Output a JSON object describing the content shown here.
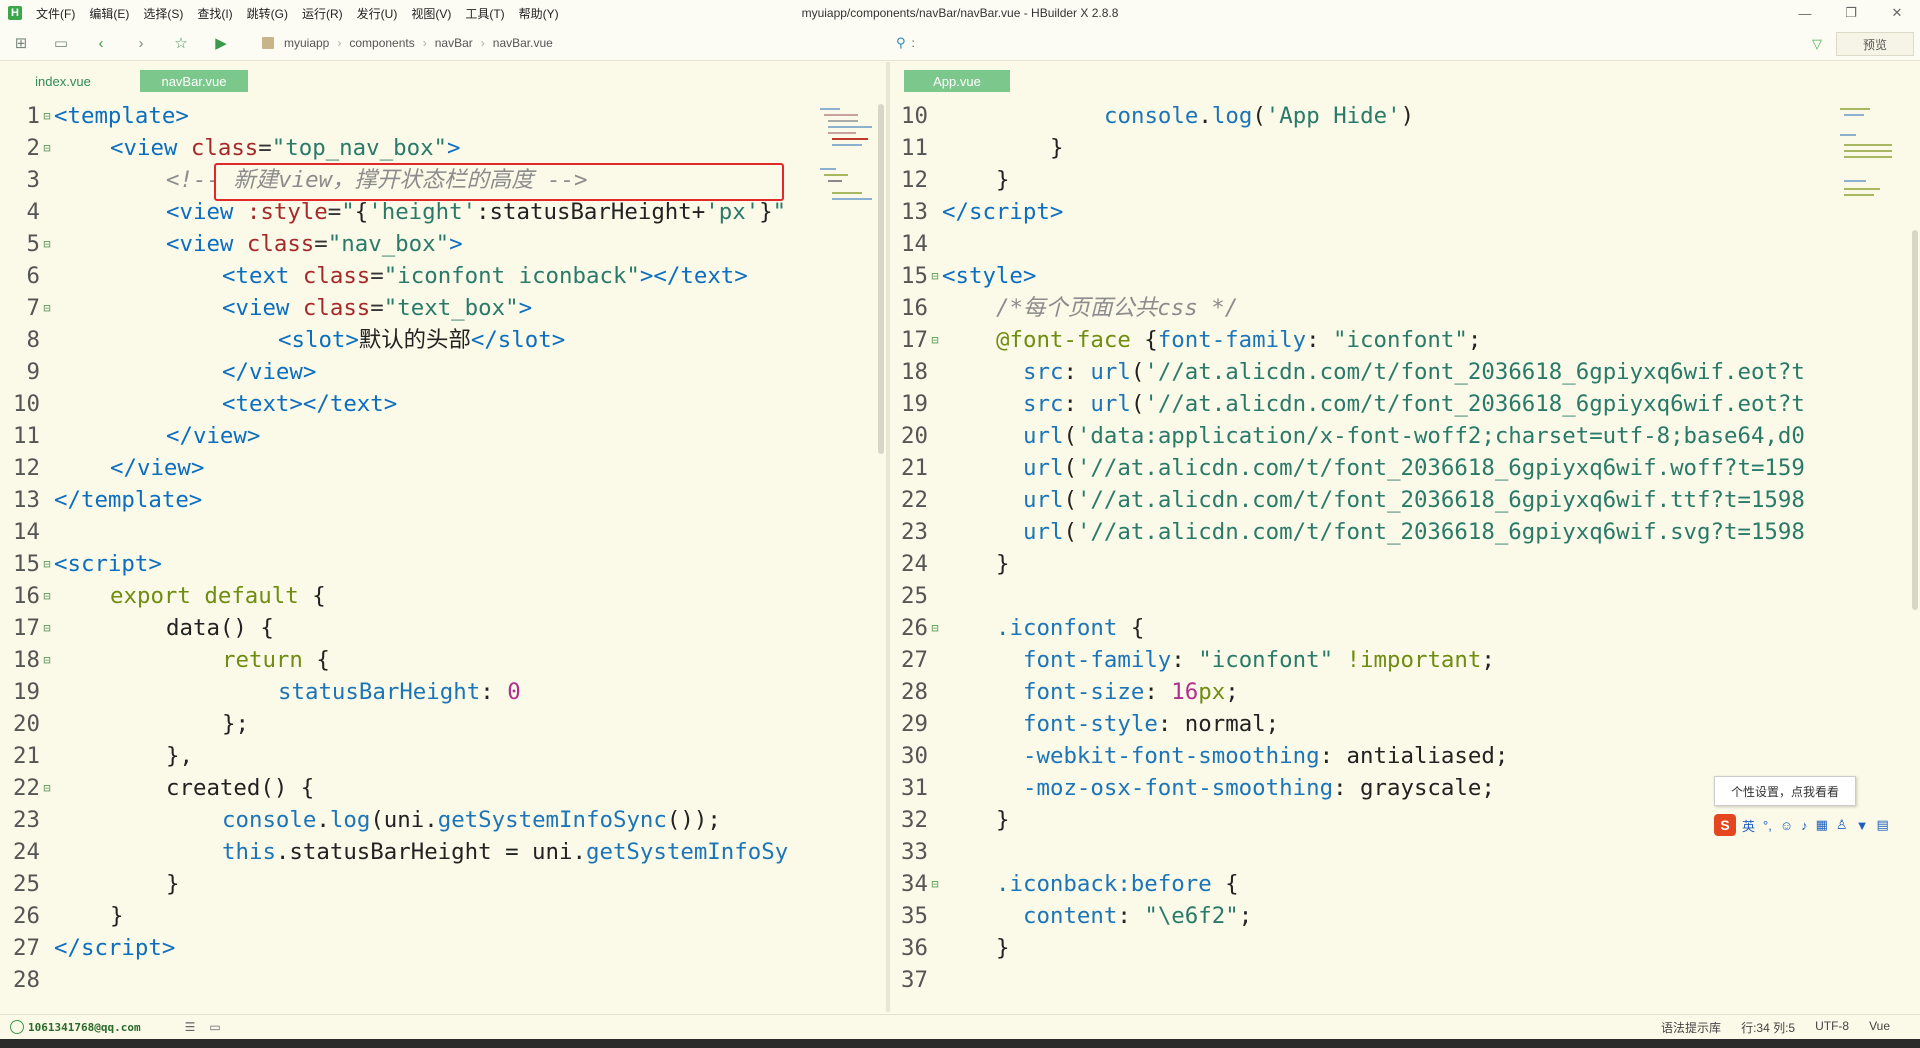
{
  "window": {
    "title": "myuiapp/components/navBar/navBar.vue - HBuilder X 2.8.8",
    "minimize": "—",
    "maximize": "❐",
    "close": "✕"
  },
  "menu": [
    "文件(F)",
    "编辑(E)",
    "选择(S)",
    "查找(I)",
    "跳转(G)",
    "运行(R)",
    "发行(U)",
    "视图(V)",
    "工具(T)",
    "帮助(Y)"
  ],
  "toolbar": {
    "breadcrumb": [
      "myuiapp",
      "components",
      "navBar",
      "navBar.vue"
    ],
    "find_value": ":",
    "preview_label": "预览"
  },
  "tabs_left": [
    {
      "label": "index.vue",
      "active": false
    },
    {
      "label": "navBar.vue",
      "active": true
    }
  ],
  "tabs_right": [
    {
      "label": "App.vue",
      "active": true
    }
  ],
  "left_editor": [
    {
      "n": 1,
      "fold": true,
      "indent": 0,
      "html": "<span class='tag'>&lt;template&gt;</span>"
    },
    {
      "n": 2,
      "fold": true,
      "indent": 1,
      "html": "<span class='tag'>&lt;view</span> <span class='attr'>class</span>=<span class='str'>\"top_nav_box\"</span><span class='tag'>&gt;</span>"
    },
    {
      "n": 3,
      "fold": false,
      "indent": 2,
      "html": "<span class='cmt'>&lt;!-- 新建view，撑开状态栏的高度 --&gt;</span>"
    },
    {
      "n": 4,
      "fold": false,
      "indent": 2,
      "html": "<span class='tag'>&lt;view</span> <span class='attr'>:style</span>=<span class='str'>\"</span><span class='txt'>{</span><span class='str'>'height'</span><span class='txt'>:statusBarHeight+</span><span class='str'>'px'</span><span class='txt'>}</span><span class='str'>\"</span>"
    },
    {
      "n": 5,
      "fold": true,
      "indent": 2,
      "html": "<span class='tag'>&lt;view</span> <span class='attr'>class</span>=<span class='str'>\"nav_box\"</span><span class='tag'>&gt;</span>"
    },
    {
      "n": 6,
      "fold": false,
      "indent": 3,
      "html": "<span class='tag'>&lt;text</span> <span class='attr'>class</span>=<span class='str'>\"iconfont iconback\"</span><span class='tag'>&gt;&lt;/text&gt;</span>"
    },
    {
      "n": 7,
      "fold": true,
      "indent": 3,
      "html": "<span class='tag'>&lt;view</span> <span class='attr'>class</span>=<span class='str'>\"text_box\"</span><span class='tag'>&gt;</span>"
    },
    {
      "n": 8,
      "fold": false,
      "indent": 4,
      "html": "<span class='tag'>&lt;slot&gt;</span><span class='txt'>默认的头部</span><span class='tag'>&lt;/slot&gt;</span>"
    },
    {
      "n": 9,
      "fold": false,
      "indent": 3,
      "html": "<span class='tag'>&lt;/view&gt;</span>"
    },
    {
      "n": 10,
      "fold": false,
      "indent": 3,
      "html": "<span class='tag'>&lt;text&gt;&lt;/text&gt;</span>"
    },
    {
      "n": 11,
      "fold": false,
      "indent": 2,
      "html": "<span class='tag'>&lt;/view&gt;</span>"
    },
    {
      "n": 12,
      "fold": false,
      "indent": 1,
      "html": "<span class='tag'>&lt;/view&gt;</span>"
    },
    {
      "n": 13,
      "fold": false,
      "indent": 0,
      "html": "<span class='tag'>&lt;/template&gt;</span>"
    },
    {
      "n": 14,
      "fold": false,
      "indent": 0,
      "html": ""
    },
    {
      "n": 15,
      "fold": true,
      "indent": 0,
      "html": "<span class='tag'>&lt;script&gt;</span>"
    },
    {
      "n": 16,
      "fold": true,
      "indent": 1,
      "html": "<span class='kw'>export default</span> <span class='txt'>{</span>"
    },
    {
      "n": 17,
      "fold": true,
      "indent": 2,
      "html": "<span class='txt'>data() {</span>"
    },
    {
      "n": 18,
      "fold": true,
      "indent": 3,
      "html": "<span class='kw'>return</span> <span class='txt'>{</span>"
    },
    {
      "n": 19,
      "fold": false,
      "indent": 4,
      "html": "<span class='prop'>statusBarHeight</span><span class='txt'>: </span><span class='num'>0</span>"
    },
    {
      "n": 20,
      "fold": false,
      "indent": 3,
      "html": "<span class='txt'>};</span>"
    },
    {
      "n": 21,
      "fold": false,
      "indent": 2,
      "html": "<span class='txt'>},</span>"
    },
    {
      "n": 22,
      "fold": true,
      "indent": 2,
      "html": "<span class='txt'>created() {</span>"
    },
    {
      "n": 23,
      "fold": false,
      "indent": 3,
      "html": "<span class='fn'>console</span><span class='txt'>.</span><span class='fn'>log</span><span class='txt'>(uni.</span><span class='fn'>getSystemInfoSync</span><span class='txt'>());</span>"
    },
    {
      "n": 24,
      "fold": false,
      "indent": 3,
      "html": "<span class='fn'>this</span><span class='txt'>.statusBarHeight = uni.</span><span class='fn'>getSystemInfoSy</span>"
    },
    {
      "n": 25,
      "fold": false,
      "indent": 2,
      "html": "<span class='txt'>}</span>"
    },
    {
      "n": 26,
      "fold": false,
      "indent": 1,
      "html": "<span class='txt'>}</span>"
    },
    {
      "n": 27,
      "fold": false,
      "indent": 0,
      "html": "<span class='tag'>&lt;/script&gt;</span>"
    },
    {
      "n": 28,
      "fold": false,
      "indent": 0,
      "html": ""
    }
  ],
  "right_editor": [
    {
      "n": 10,
      "fold": false,
      "indent": 6,
      "html": "<span class='fn'>console</span><span class='txt'>.</span><span class='fn'>log</span><span class='txt'>(</span><span class='str'>'App Hide'</span><span class='txt'>)</span>"
    },
    {
      "n": 11,
      "fold": false,
      "indent": 4,
      "html": "<span class='txt'>}</span>"
    },
    {
      "n": 12,
      "fold": false,
      "indent": 2,
      "html": "<span class='txt'>}</span>"
    },
    {
      "n": 13,
      "fold": false,
      "indent": 0,
      "html": "<span class='tag'>&lt;/script&gt;</span>"
    },
    {
      "n": 14,
      "fold": false,
      "indent": 0,
      "html": ""
    },
    {
      "n": 15,
      "fold": true,
      "indent": 0,
      "html": "<span class='tag'>&lt;style&gt;</span>"
    },
    {
      "n": 16,
      "fold": false,
      "indent": 2,
      "html": "<span class='cmt'>/*每个页面公共css */</span>"
    },
    {
      "n": 17,
      "fold": true,
      "indent": 2,
      "html": "<span class='kw'>@font-face</span> <span class='txt'>{</span><span class='prop'>font-family</span><span class='txt'>: </span><span class='str'>\"iconfont\"</span><span class='txt'>;</span>"
    },
    {
      "n": 18,
      "fold": false,
      "indent": 3,
      "html": "<span class='prop'>src</span><span class='txt'>: </span><span class='fn'>url</span><span class='txt'>(</span><span class='str'>'//at.alicdn.com/t/font_2036618_6gpiyxq6wif.eot?t</span>"
    },
    {
      "n": 19,
      "fold": false,
      "indent": 3,
      "html": "<span class='prop'>src</span><span class='txt'>: </span><span class='fn'>url</span><span class='txt'>(</span><span class='str'>'//at.alicdn.com/t/font_2036618_6gpiyxq6wif.eot?t</span>"
    },
    {
      "n": 20,
      "fold": false,
      "indent": 3,
      "html": "<span class='fn'>url</span><span class='txt'>(</span><span class='str'>'data:application/x-font-woff2;charset=utf-8;base64,d0</span>"
    },
    {
      "n": 21,
      "fold": false,
      "indent": 3,
      "html": "<span class='fn'>url</span><span class='txt'>(</span><span class='str'>'//at.alicdn.com/t/font_2036618_6gpiyxq6wif.woff?t=159</span>"
    },
    {
      "n": 22,
      "fold": false,
      "indent": 3,
      "html": "<span class='fn'>url</span><span class='txt'>(</span><span class='str'>'//at.alicdn.com/t/font_2036618_6gpiyxq6wif.ttf?t=1598</span>"
    },
    {
      "n": 23,
      "fold": false,
      "indent": 3,
      "html": "<span class='fn'>url</span><span class='txt'>(</span><span class='str'>'//at.alicdn.com/t/font_2036618_6gpiyxq6wif.svg?t=1598</span>"
    },
    {
      "n": 24,
      "fold": false,
      "indent": 2,
      "html": "<span class='txt'>}</span>"
    },
    {
      "n": 25,
      "fold": false,
      "indent": 0,
      "html": ""
    },
    {
      "n": 26,
      "fold": true,
      "indent": 2,
      "html": "<span class='sel'>.iconfont</span> <span class='txt'>{</span>"
    },
    {
      "n": 27,
      "fold": false,
      "indent": 3,
      "html": "<span class='prop'>font-family</span><span class='txt'>: </span><span class='str'>\"iconfont\"</span> <span class='kw'>!important</span><span class='txt'>;</span>"
    },
    {
      "n": 28,
      "fold": false,
      "indent": 3,
      "html": "<span class='prop'>font-size</span><span class='txt'>: </span><span class='num'>16</span><span class='kw'>px</span><span class='txt'>;</span>"
    },
    {
      "n": 29,
      "fold": false,
      "indent": 3,
      "html": "<span class='prop'>font-style</span><span class='txt'>: normal;</span>"
    },
    {
      "n": 30,
      "fold": false,
      "indent": 3,
      "html": "<span class='prop'>-webkit-font-smoothing</span><span class='txt'>: antialiased;</span>"
    },
    {
      "n": 31,
      "fold": false,
      "indent": 3,
      "html": "<span class='prop'>-moz-osx-font-smoothing</span><span class='txt'>: grayscale;</span>"
    },
    {
      "n": 32,
      "fold": false,
      "indent": 2,
      "html": "<span class='txt'>}</span>"
    },
    {
      "n": 33,
      "fold": false,
      "indent": 0,
      "html": ""
    },
    {
      "n": 34,
      "fold": true,
      "indent": 2,
      "html": "<span class='sel'>.iconback:before</span> <span class='txt'>{</span>"
    },
    {
      "n": 35,
      "fold": false,
      "indent": 3,
      "html": "<span class='prop'>content</span><span class='txt'>: </span><span class='str'>\"\\e6f2\"</span><span class='txt'>;</span>"
    },
    {
      "n": 36,
      "fold": false,
      "indent": 2,
      "html": "<span class='txt'>}</span>"
    },
    {
      "n": 37,
      "fold": false,
      "indent": 0,
      "html": ""
    }
  ],
  "tooltip": "个性设置，点我看看",
  "ime": {
    "logo": "S",
    "lang": "英"
  },
  "status": {
    "user": "1061341768@qq.com",
    "hint": "语法提示库",
    "position": "行:34  列:5",
    "encoding": "UTF-8",
    "language": "Vue"
  }
}
